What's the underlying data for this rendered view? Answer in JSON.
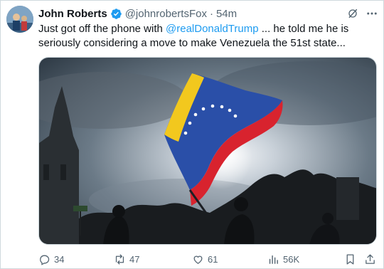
{
  "tweet": {
    "author_name": "John Roberts",
    "handle": "@johnrobertsFox",
    "separator": "·",
    "time": "54m",
    "text_before": "Just got off the phone with ",
    "mention": "@realDonaldTrump",
    "text_after": " ... he told me he is seriously considering a move to make Venezuela the 51st state..."
  },
  "icons": {
    "verified": "verified-badge-icon",
    "grok": "grok-icon",
    "more": "more-icon",
    "reply": "reply-icon",
    "retweet": "retweet-icon",
    "like": "like-icon",
    "views": "views-icon",
    "bookmark": "bookmark-icon",
    "share": "share-icon"
  },
  "actions": {
    "replies": "34",
    "retweets": "47",
    "likes": "61",
    "views": "56K"
  },
  "colors": {
    "accent": "#1d9bf0",
    "text": "#0f1419",
    "muted": "#536471",
    "flag_yellow": "#f2c81e",
    "flag_blue": "#2a4fa8",
    "flag_red": "#d8232e"
  }
}
